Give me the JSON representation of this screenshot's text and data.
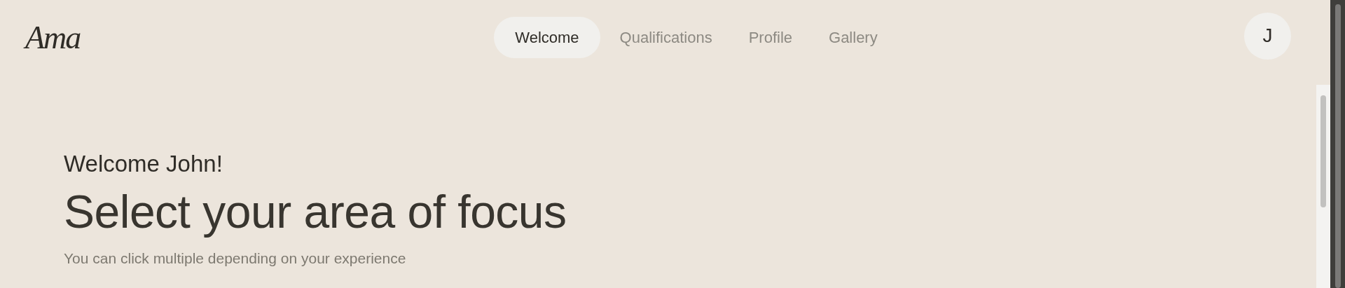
{
  "logo": "Ama",
  "nav": [
    {
      "label": "Welcome",
      "selected": true
    },
    {
      "label": "Qualifications",
      "selected": false
    },
    {
      "label": "Profile",
      "selected": false
    },
    {
      "label": "Gallery",
      "selected": false
    }
  ],
  "avatar": "J",
  "greeting": "Welcome John!",
  "heading": "Select your area of focus",
  "subtitle": "You can click multiple depending on your experience"
}
